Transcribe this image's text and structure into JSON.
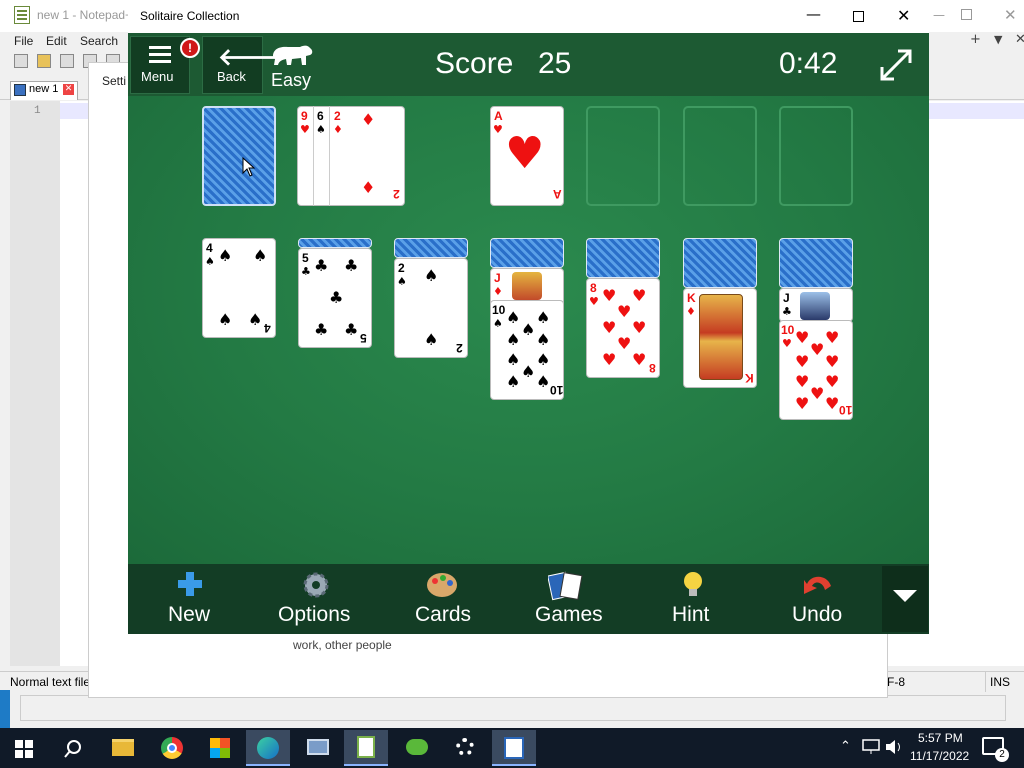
{
  "notepad": {
    "title": "new 1 - Notepad+",
    "menu": [
      "File",
      "Edit",
      "Search"
    ],
    "tab_label": "new 1",
    "line_number": "1",
    "status_text": "Normal text file",
    "status_encoding": "F-8",
    "status_mode": "INS"
  },
  "settings": {
    "title_fragment": "Setti",
    "text_fragment": "work, other people"
  },
  "solitaire": {
    "window_title": "Solitaire Collection",
    "menu_label": "Menu",
    "menu_badge": "!",
    "back_label": "Back",
    "difficulty": "Easy",
    "score_label": "Score",
    "score_value": "25",
    "timer": "0:42",
    "bottom_buttons": [
      {
        "label": "New",
        "icon": "plus-icon"
      },
      {
        "label": "Options",
        "icon": "gear-icon"
      },
      {
        "label": "Cards",
        "icon": "palette-icon"
      },
      {
        "label": "Games",
        "icon": "cards-icon"
      },
      {
        "label": "Hint",
        "icon": "lightbulb-icon"
      },
      {
        "label": "Undo",
        "icon": "undo-icon"
      }
    ],
    "waste": [
      {
        "rank": "9",
        "suit": "♥",
        "color": "red"
      },
      {
        "rank": "6",
        "suit": "♠",
        "color": "black"
      },
      {
        "rank": "2",
        "suit": "♦",
        "color": "red"
      }
    ],
    "foundations": [
      {
        "rank": "A",
        "suit": "♥",
        "color": "red"
      }
    ],
    "tableau": [
      {
        "rank": "4",
        "suit": "♠",
        "color": "black"
      },
      {
        "rank": "5",
        "suit": "♣",
        "color": "black"
      },
      {
        "rank": "2",
        "suit": "♠",
        "color": "black"
      },
      {
        "rank": "10",
        "suit": "♠",
        "color": "black",
        "under": {
          "rank": "J",
          "suit": "♦",
          "color": "red"
        }
      },
      {
        "rank": "8",
        "suit": "♥",
        "color": "red"
      },
      {
        "rank": "K",
        "suit": "♦",
        "color": "red"
      },
      {
        "rank": "10",
        "suit": "♥",
        "color": "red",
        "under": {
          "rank": "J",
          "suit": "♣",
          "color": "black"
        }
      }
    ]
  },
  "taskbar": {
    "time": "5:57 PM",
    "date": "11/17/2022",
    "notifications": "2"
  },
  "colors": {
    "felt": "#237a44",
    "header": "#1d5a33",
    "bottom_bar": "#133d25",
    "taskbar": "#101a28"
  }
}
